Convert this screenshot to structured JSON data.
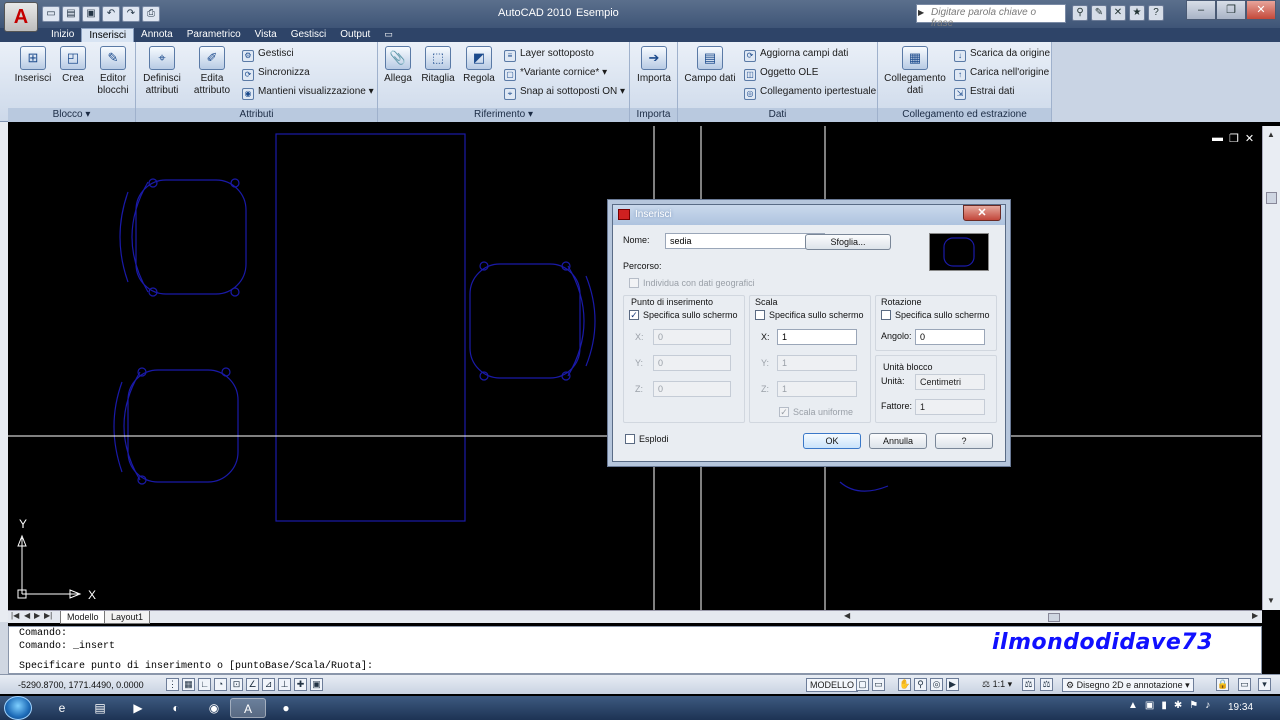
{
  "titlebar": {
    "app_name": "AutoCAD 2010",
    "document": "Esempio",
    "search_placeholder": "Digitare parola chiave o frase",
    "app_button_glyph": "A"
  },
  "tabs": [
    "Inizio",
    "Inserisci",
    "Annota",
    "Parametrico",
    "Vista",
    "Gestisci",
    "Output"
  ],
  "active_tab": "Inserisci",
  "ribbon": {
    "blocco": {
      "title": "Blocco ▾",
      "buttons": [
        "Inserisci",
        "Crea",
        "Editor blocchi"
      ]
    },
    "attributi": {
      "title": "Attributi",
      "buttons": [
        "Definisci attributi",
        "Edita attributo"
      ],
      "small": [
        "Gestisci",
        "Sincronizza",
        "Mantieni visualizzazione"
      ]
    },
    "riferimento": {
      "title": "Riferimento ▾",
      "buttons": [
        "Allega",
        "Ritaglia",
        "Regola"
      ],
      "small": [
        "Layer sottoposto",
        "*Variante cornice*",
        "Snap ai sottoposti ON"
      ]
    },
    "importa": {
      "title": "Importa",
      "buttons": [
        "Importa"
      ]
    },
    "dati": {
      "title": "Dati",
      "buttons": [
        "Campo dati"
      ],
      "small": [
        "Aggiorna campi dati",
        "Oggetto OLE",
        "Collegamento ipertestuale"
      ]
    },
    "collegamento": {
      "title": "Collegamento ed estrazione",
      "buttons": [
        "Collegamento dati"
      ],
      "small": [
        "Scarica da origine",
        "Carica nell'origine",
        "Estrai dati"
      ]
    }
  },
  "layout_tabs": [
    "Modello",
    "Layout1"
  ],
  "command": {
    "line1": "Comando:",
    "line2": "Comando:  _insert",
    "line3": "Specificare punto di inserimento o [puntoBase/Scala/Ruota]:"
  },
  "watermark": "ilmondodidave73",
  "status": {
    "coords": "-5290.8700, 1771.4490, 0.0000",
    "model": "MODELLO",
    "scale": "1:1",
    "workspace": "Disegno 2D e annotazione"
  },
  "clock": "19:34",
  "ucs": {
    "x_label": "X",
    "y_label": "Y"
  },
  "dialog": {
    "title": "Inserisci",
    "name_label": "Nome:",
    "name_value": "sedia",
    "browse": "Sfoglia...",
    "path_label": "Percorso:",
    "geo_label": "Individua con dati geografici",
    "insertion": {
      "title": "Punto di inserimento",
      "on_screen": "Specifica sullo schermo",
      "x_label": "X:",
      "y_label": "Y:",
      "z_label": "Z:",
      "x": "0",
      "y": "0",
      "z": "0",
      "on_screen_checked": true
    },
    "scale": {
      "title": "Scala",
      "on_screen": "Specifica sullo schermo",
      "x_label": "X:",
      "y_label": "Y:",
      "z_label": "Z:",
      "x": "1",
      "y": "1",
      "z": "1",
      "uniform": "Scala uniforme",
      "on_screen_checked": false
    },
    "rotation": {
      "title": "Rotazione",
      "on_screen": "Specifica sullo schermo",
      "angle_label": "Angolo:",
      "angle": "0",
      "on_screen_checked": false
    },
    "block_unit": {
      "title": "Unità blocco",
      "unit_label": "Unità:",
      "unit": "Centimetri",
      "factor_label": "Fattore:",
      "factor": "1"
    },
    "explode": "Esplodi",
    "ok": "OK",
    "cancel": "Annulla",
    "help": "?"
  },
  "colors": {
    "drawing_bg": "#000000",
    "chair_lines": "#1a1aa8",
    "crosshair": "#ffffff",
    "watermark": "#1010ff"
  }
}
